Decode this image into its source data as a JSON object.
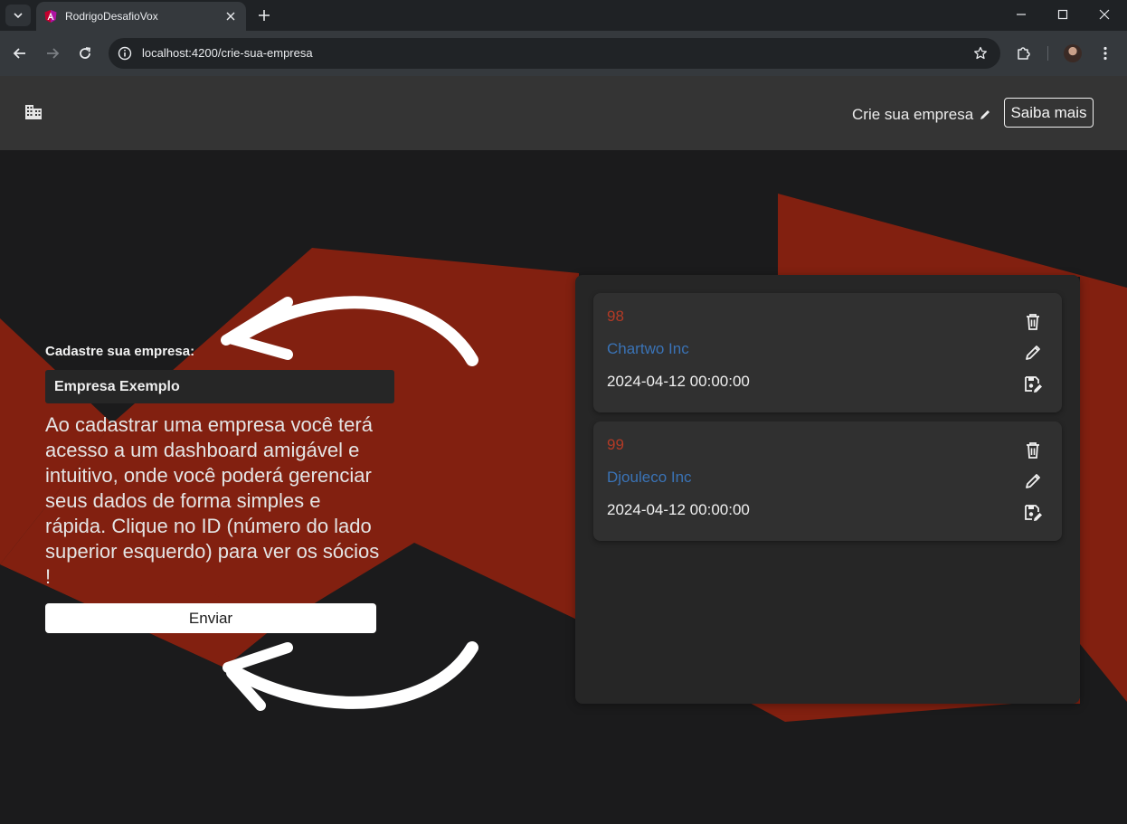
{
  "browser": {
    "tab_title": "RodrigoDesafioVox",
    "url": "localhost:4200/crie-sua-empresa"
  },
  "header": {
    "nav_link": "Crie sua empresa",
    "saiba_label": "Saiba mais"
  },
  "form": {
    "label": "Cadastre sua empresa:",
    "input_value": "Empresa Exemplo",
    "description": "Ao cadastrar uma empresa você terá acesso a um dashboard amigável e intuitivo, onde você poderá gerenciar seus dados de forma simples e rápida. Clique no ID (número do lado superior esquerdo) para ver os sócios !",
    "submit_label": "Enviar"
  },
  "companies": [
    {
      "id": "98",
      "name": "Chartwo Inc",
      "date": "2024-04-12 00:00:00"
    },
    {
      "id": "99",
      "name": "Djouleco Inc",
      "date": "2024-04-12 00:00:00"
    }
  ],
  "colors": {
    "accent_red": "#822010",
    "id_red": "#b33a25",
    "name_blue": "#3a73b6"
  },
  "icons": {
    "logo": "building-icon",
    "nav": "pencil-icon",
    "card_actions": [
      "trash-icon",
      "edit-icon",
      "save-edit-icon"
    ]
  }
}
